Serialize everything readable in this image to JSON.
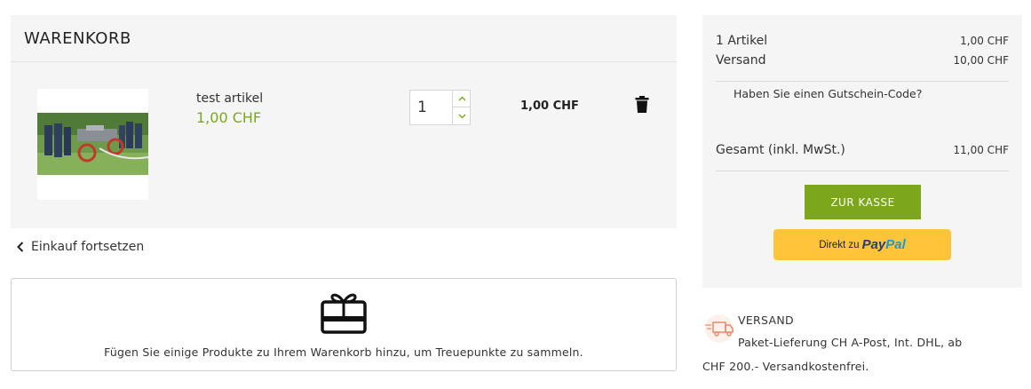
{
  "cart": {
    "title": "WARENKORB",
    "item": {
      "image_icon": "product-photo",
      "name": "test artikel",
      "unit_price": "1,00 CHF",
      "quantity": "1",
      "line_total": "1,00 CHF"
    },
    "continue_label": "Einkauf fortsetzen",
    "loyalty_icon": "gift-card-icon",
    "loyalty_text": "Fügen Sie einige Produkte zu Ihrem Warenkorb hinzu, um Treuepunkte zu sammeln."
  },
  "summary": {
    "items_label": "1 Artikel",
    "items_value": "1,00 CHF",
    "shipping_label": "Versand",
    "shipping_value": "10,00 CHF",
    "voucher_label": "Haben Sie einen Gutschein-Code?",
    "total_label": "Gesamt (inkl. MwSt.)",
    "total_value": "11,00 CHF",
    "checkout_label": "ZUR KASSE",
    "paypal_prefix": "Direkt zu",
    "paypal_logo_part1": "Pay",
    "paypal_logo_part2": "Pal"
  },
  "shipping_info": {
    "icon": "delivery-truck-icon",
    "title": "VERSAND",
    "line1": "Paket-Lieferung CH A-Post, Int. DHL, ab",
    "line2": "CHF 200.- Versandkostenfrei."
  },
  "colors": {
    "accent_green": "#7ca71d",
    "paypal_yellow": "#ffc439",
    "panel_bg": "#f5f5f5"
  }
}
